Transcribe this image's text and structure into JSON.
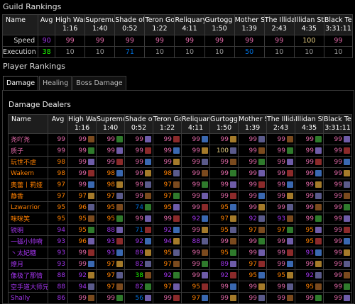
{
  "guild_rankings": {
    "title": "Guild Rankings",
    "columns": [
      "Name",
      "Avg",
      "High Warl",
      "Supremus",
      "Shade of A",
      "Teron Gor",
      "Reliquary",
      "Gurtogg B",
      "Mother Sh",
      "The Illidari",
      "Illidan Sto",
      "Black Tem"
    ],
    "times": [
      "",
      "",
      "1:16",
      "1:40",
      "0:52",
      "1:22",
      "4:11",
      "1:50",
      "1:39",
      "2:43",
      "4:35",
      "3:31:11"
    ],
    "rows": [
      {
        "label": "Speed",
        "avg": "90",
        "values": [
          "99",
          "99",
          "99",
          "99",
          "99",
          "99",
          "99",
          "99",
          "100",
          "99"
        ]
      },
      {
        "label": "Execution",
        "avg": "38",
        "values": [
          "10",
          "10",
          "71",
          "10",
          "10",
          "10",
          "50",
          "10",
          "10",
          "10"
        ]
      }
    ]
  },
  "player_rankings": {
    "title": "Player Rankings"
  },
  "tabs": [
    "Damage",
    "Healing",
    "Boss Damage"
  ],
  "damage_dealers": {
    "title": "Damage Dealers",
    "columns": [
      "Name",
      "Avg",
      "High Warl",
      "Supremus",
      "Shade of A",
      "Teron Gor",
      "Reliquary",
      "Gurtogg B",
      "Mother Sh",
      "The Illidari",
      "Illidan Sto",
      "Black Tem"
    ],
    "times": [
      "",
      "",
      "1:16",
      "1:40",
      "0:52",
      "1:22",
      "4:11",
      "1:50",
      "1:39",
      "2:43",
      "4:35",
      "3:31:11"
    ],
    "players": [
      {
        "name": "尧吖尧",
        "avg": "99",
        "values": [
          "99",
          "99",
          "99",
          "99",
          "99",
          "99",
          "99",
          "99",
          "99",
          "99"
        ]
      },
      {
        "name": "质子",
        "avg": "99",
        "values": [
          "99",
          "99",
          "99",
          "99",
          "99",
          "100",
          "99",
          "99",
          "99",
          "99"
        ]
      },
      {
        "name": "玩世不虐",
        "avg": "98",
        "values": [
          "99",
          "99",
          "99",
          "99",
          "99",
          "99",
          "99",
          "99",
          "99",
          "99"
        ]
      },
      {
        "name": "Wakem",
        "avg": "98",
        "values": [
          "99",
          "98",
          "99",
          "98",
          "99",
          "99",
          "99",
          "99",
          "99",
          "99"
        ]
      },
      {
        "name": "奥蕾丨莉娅",
        "avg": "97",
        "values": [
          "99",
          "98",
          "99",
          "97",
          "99",
          "99",
          "99",
          "99",
          "99",
          "99"
        ]
      },
      {
        "name": "静香",
        "avg": "97",
        "values": [
          "97",
          "97",
          "99",
          "97",
          "99",
          "99",
          "99",
          "99",
          "99",
          "99"
        ]
      },
      {
        "name": "Lzwarrior",
        "avg": "95",
        "values": [
          "96",
          "95",
          "74",
          "95",
          "99",
          "95",
          "99",
          "99",
          "99",
          "99"
        ]
      },
      {
        "name": "咪咪笑",
        "avg": "95",
        "values": [
          "95",
          "95",
          "99",
          "99",
          "92",
          "97",
          "92",
          "93",
          "99",
          "99"
        ]
      },
      {
        "name": "锐明",
        "avg": "94",
        "values": [
          "95",
          "88",
          "71",
          "92",
          "99",
          "95",
          "97",
          "97",
          "95",
          "99"
        ]
      },
      {
        "name": "一磁小帅嗬",
        "avg": "93",
        "values": [
          "96",
          "93",
          "92",
          "94",
          "88",
          "99",
          "99",
          "99",
          "95",
          "99"
        ]
      },
      {
        "name": "丶太妃糖",
        "avg": "93",
        "values": [
          "99",
          "93",
          "89",
          "95",
          "99",
          "95",
          "99",
          "99",
          "93",
          "99"
        ]
      },
      {
        "name": "燎月",
        "avg": "93",
        "values": [
          "99",
          "97",
          "82",
          "97",
          "99",
          "89",
          "97",
          "99",
          "99",
          "99"
        ]
      },
      {
        "name": "像极了那情",
        "avg": "88",
        "values": [
          "92",
          "97",
          "38",
          "92",
          "99",
          "92",
          "95",
          "95",
          "92",
          "99"
        ]
      },
      {
        "name": "空手道大师兄",
        "avg": "88",
        "values": [
          "94",
          "97",
          "82",
          "97",
          "95",
          "99",
          "99",
          "99",
          "95",
          "99"
        ]
      },
      {
        "name": "Shally",
        "avg": "86",
        "values": [
          "99",
          "99",
          "56",
          "99",
          "97",
          "99",
          "99",
          "99",
          "99",
          "99"
        ]
      }
    ]
  },
  "colors": {
    "legendary": "#e5cc80",
    "pink": "#e268a8",
    "orange": "#ff8000",
    "epic": "#a335ee",
    "rare": "#0070dd",
    "uncommon": "#1eff00",
    "common": "#999999"
  }
}
